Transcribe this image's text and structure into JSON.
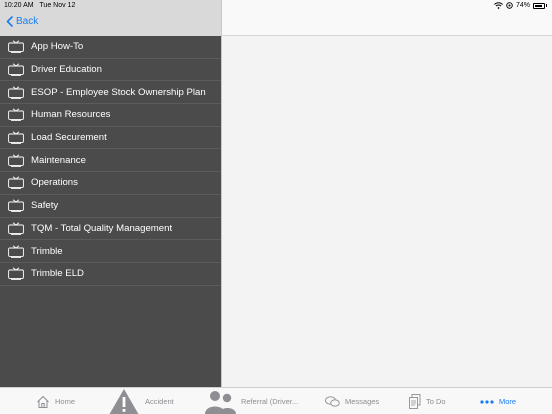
{
  "status_bar": {
    "time": "10:20 AM",
    "date": "Tue Nov 12",
    "battery": "74%"
  },
  "header": {
    "back_label": "Back"
  },
  "list": [
    {
      "label": "App How-To"
    },
    {
      "label": "Driver Education"
    },
    {
      "label": "ESOP - Employee Stock Ownership Plan"
    },
    {
      "label": "Human Resources"
    },
    {
      "label": "Load Securement"
    },
    {
      "label": "Maintenance"
    },
    {
      "label": "Operations"
    },
    {
      "label": "Safety"
    },
    {
      "label": "TQM - Total Quality Management"
    },
    {
      "label": "Trimble"
    },
    {
      "label": "Trimble ELD"
    }
  ],
  "tabs": {
    "home": "Home",
    "accident": "Accident",
    "referral": "Referral (Driver...",
    "messages": "Messages",
    "todo": "To Do",
    "more": "More"
  },
  "colors": {
    "accent": "#1a7cf0",
    "sidebar_bg": "#4b4b4b",
    "inactive_tab": "#8e8e93"
  },
  "icons": {
    "list_item": "tv-icon",
    "home": "house-icon",
    "accident": "warning-triangle-icon",
    "referral": "people-icon",
    "messages": "chat-bubbles-icon",
    "todo": "documents-icon",
    "more": "ellipsis-icon"
  }
}
